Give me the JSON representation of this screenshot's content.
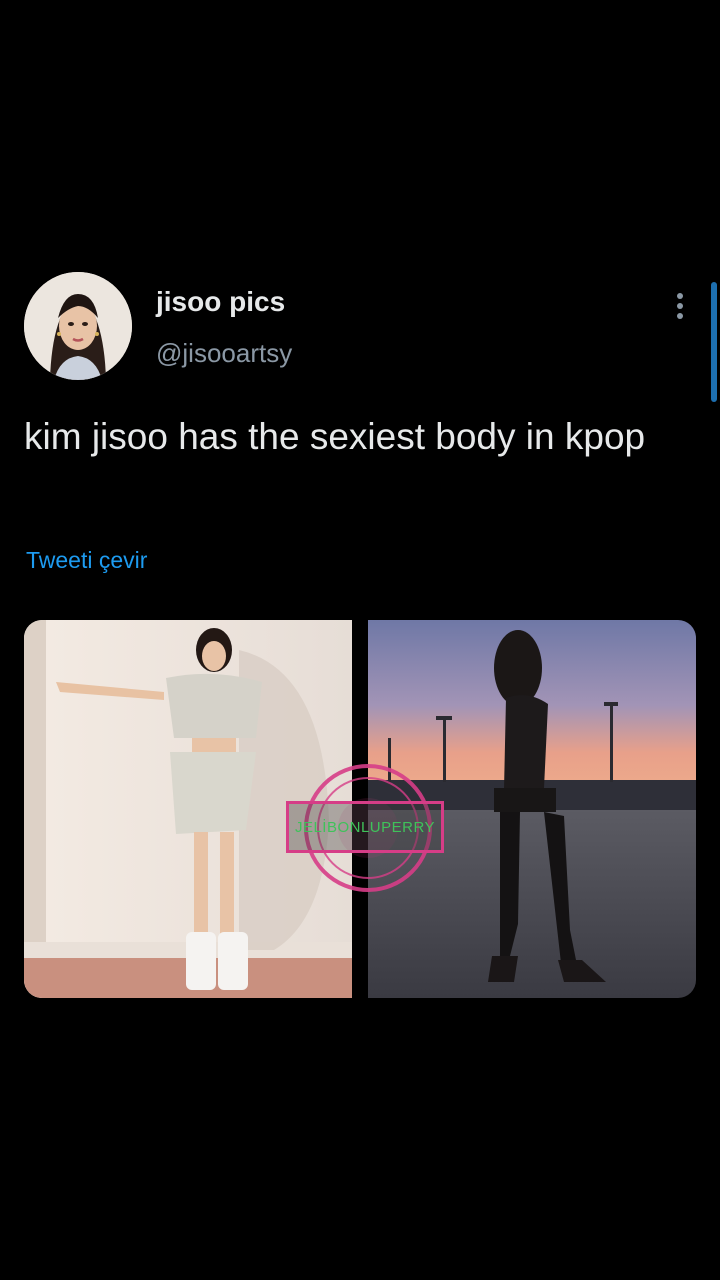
{
  "tweet": {
    "author": {
      "display_name": "jisoo pics",
      "handle": "@jisooartsy"
    },
    "text": "kim jisoo has the sexiest body in kpop",
    "translate_label": "Tweeti çevir",
    "media": [
      {
        "description_icon": "photo-left"
      },
      {
        "description_icon": "photo-right"
      }
    ],
    "watermark": {
      "text": "JELİBONLUPERRY"
    }
  },
  "colors": {
    "background": "#000000",
    "text_primary": "#e7e9ea",
    "text_secondary": "#8b98a5",
    "link": "#1d9bf0",
    "watermark_border": "#d63d87",
    "watermark_text": "#3fc25a"
  }
}
